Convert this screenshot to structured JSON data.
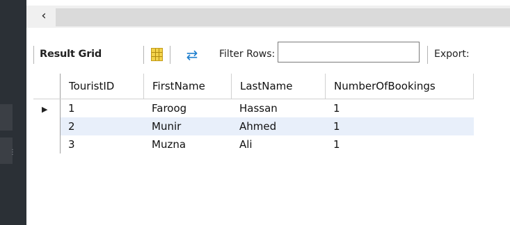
{
  "toolbar": {
    "title": "Result Grid",
    "filter_label": "Filter Rows:",
    "filter_value": "",
    "export_label": "Export:"
  },
  "icons": {
    "scroll_left": "chevron-left-icon",
    "grid": "grid-layout-icon",
    "refresh": "refresh-icon",
    "row_pointer": "row-pointer-icon"
  },
  "grid": {
    "columns": [
      "TouristID",
      "FirstName",
      "LastName",
      "NumberOfBookings"
    ],
    "rows": [
      {
        "TouristID": "1",
        "FirstName": "Faroog",
        "LastName": "Hassan",
        "NumberOfBookings": "1"
      },
      {
        "TouristID": "2",
        "FirstName": "Munir",
        "LastName": "Ahmed",
        "NumberOfBookings": "1"
      },
      {
        "TouristID": "3",
        "FirstName": "Muzna",
        "LastName": "Ali",
        "NumberOfBookings": "1"
      }
    ]
  },
  "colors": {
    "background_dark": "#2b3036",
    "row_highlight": "#e8effa",
    "refresh_icon": "#1f7fce",
    "grid_icon": "#f2d24b"
  }
}
